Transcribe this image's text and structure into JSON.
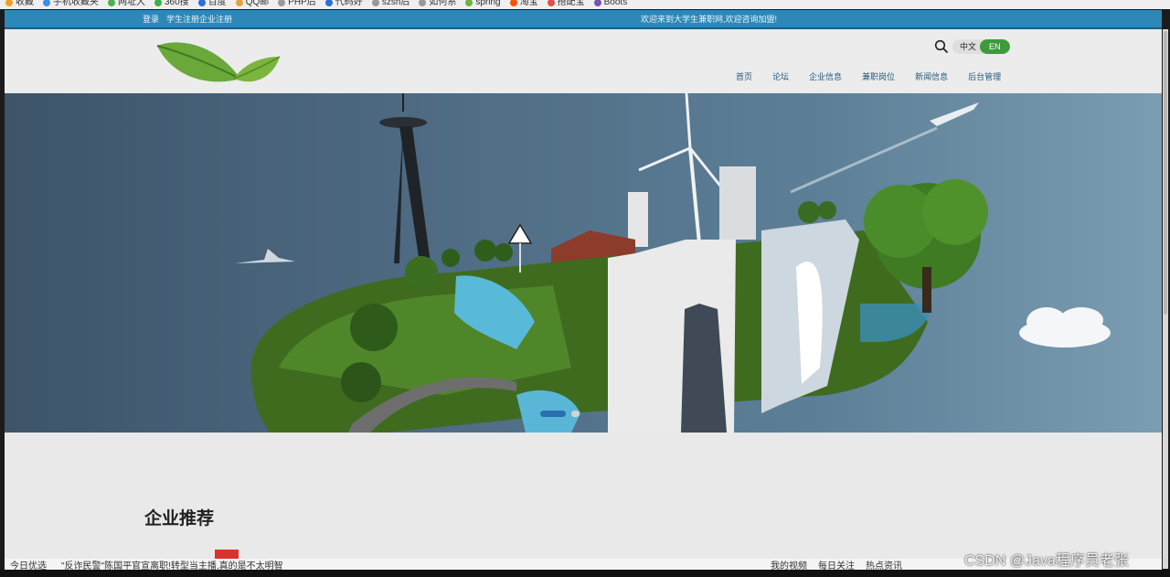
{
  "bookmarks": [
    {
      "label": "收藏",
      "color": "#f0a020"
    },
    {
      "label": "手机收藏夹",
      "color": "#3a8ee6"
    },
    {
      "label": "网址大",
      "color": "#4caf50"
    },
    {
      "label": "360搜",
      "color": "#3cb043"
    },
    {
      "label": "百度",
      "color": "#2e6ed6"
    },
    {
      "label": "QQ邮",
      "color": "#e6a23c"
    },
    {
      "label": "PHP后",
      "color": "#999999"
    },
    {
      "label": "代码好",
      "color": "#2e6ed6"
    },
    {
      "label": "szsh后",
      "color": "#999999"
    },
    {
      "label": "如何系",
      "color": "#999999"
    },
    {
      "label": "spring",
      "color": "#6db33f"
    },
    {
      "label": "淘宝",
      "color": "#ff5000"
    },
    {
      "label": "搭配宝",
      "color": "#e34d4d"
    },
    {
      "label": "Boots",
      "color": "#7952b3"
    }
  ],
  "topbar": {
    "login": "登录",
    "register": "学生注册企业注册",
    "welcome": "欢迎来到大学生兼职网,欢迎咨询加盟!"
  },
  "header": {
    "lang_zh": "中文",
    "lang_en": "EN",
    "nav": [
      "首页",
      "论坛",
      "企业信息",
      "兼职岗位",
      "新闻信息",
      "后台管理"
    ]
  },
  "main": {
    "section_title": "企业推荐"
  },
  "statusbar": {
    "left": [
      "今日优选",
      "\"反诈民警\"陈国平官宣离职!转型当主播,真的是不太明智"
    ],
    "right": [
      "我的视频",
      "每日关注",
      "热点资讯"
    ]
  },
  "watermark": "CSDN @Java程序员老张",
  "colors": {
    "topbar": "#2d87b7",
    "nav_text": "#245a7a",
    "lang_active": "#3f9a3c",
    "pager_active": "#2a6fb0"
  }
}
